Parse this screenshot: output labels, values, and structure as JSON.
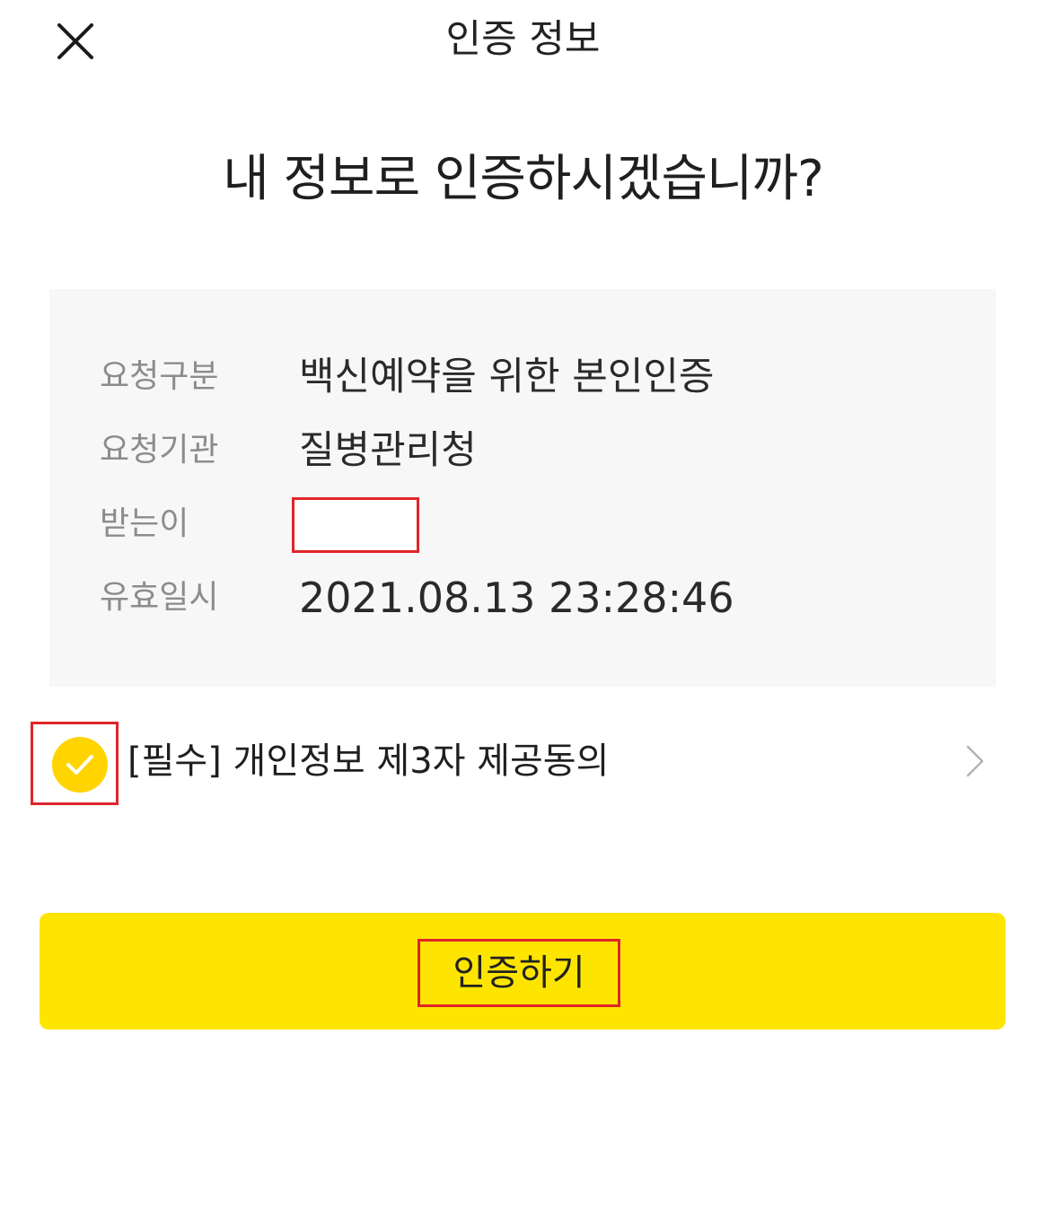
{
  "header": {
    "title": "인증 정보",
    "close_icon": "close-icon"
  },
  "headline": "내 정보로 인증하시겠습니까?",
  "info": {
    "rows": [
      {
        "label": "요청구분",
        "value": "백신예약을 위한 본인인증"
      },
      {
        "label": "요청기관",
        "value": "질병관리청"
      },
      {
        "label": "받는이",
        "value": ""
      },
      {
        "label": "유효일시",
        "value": "2021.08.13 23:28:46"
      }
    ]
  },
  "consent": {
    "label": "[필수] 개인정보 제3자 제공동의",
    "checked": true,
    "check_icon": "check-icon",
    "arrow_icon": "chevron-right-icon"
  },
  "action": {
    "label": "인증하기"
  },
  "colors": {
    "accent": "#fee500",
    "check": "#ffd400",
    "highlight": "#e0252b",
    "card_bg": "#f7f7f7",
    "label_gray": "#8c8c8c"
  }
}
